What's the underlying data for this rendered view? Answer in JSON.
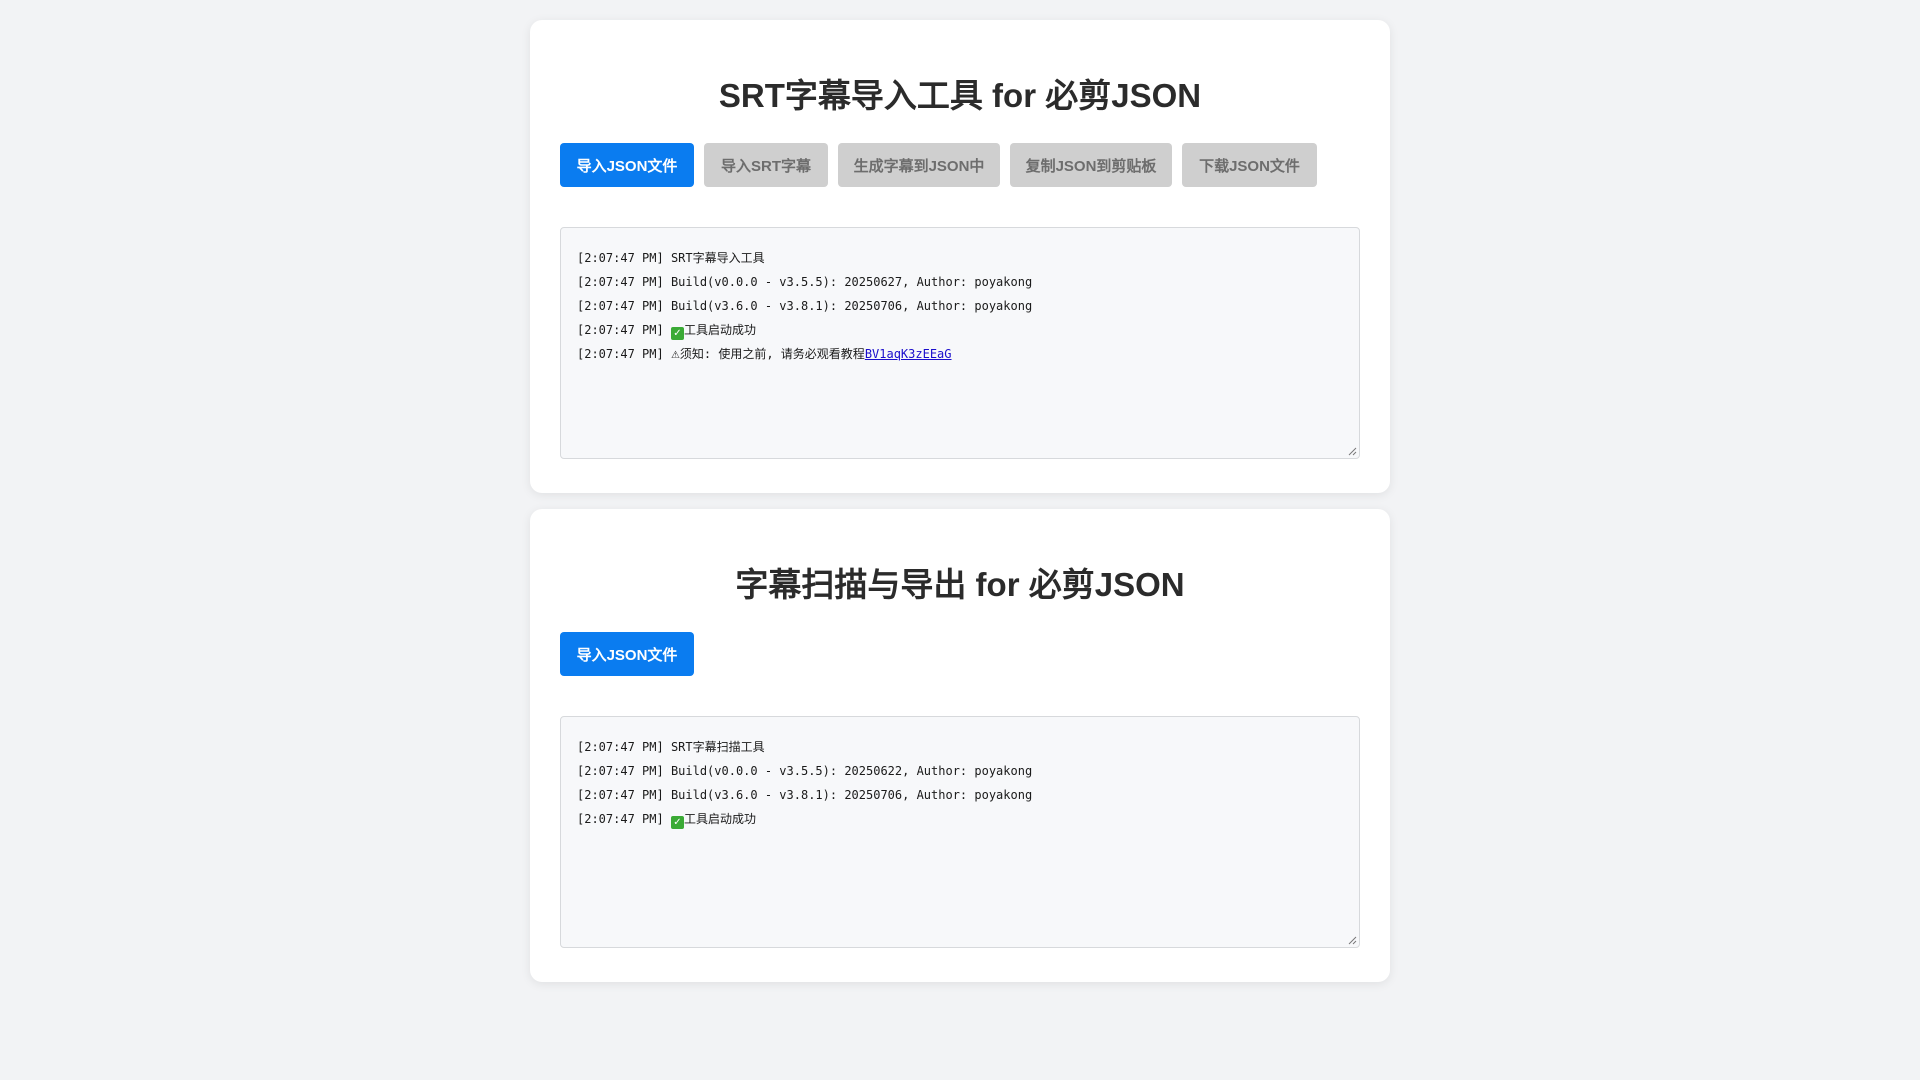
{
  "importer": {
    "title": "SRT字幕导入工具 for 必剪JSON",
    "buttons": [
      {
        "label": "导入JSON文件",
        "state": "active"
      },
      {
        "label": "导入SRT字幕",
        "state": "disabled"
      },
      {
        "label": "生成字幕到JSON中",
        "state": "disabled"
      },
      {
        "label": "复制JSON到剪贴板",
        "state": "disabled"
      },
      {
        "label": "下载JSON文件",
        "state": "disabled"
      }
    ],
    "log": [
      {
        "time": "[2:07:47 PM]",
        "text": "SRT字幕导入工具"
      },
      {
        "time": "[2:07:47 PM]",
        "text": "Build(v0.0.0 - v3.5.5): 20250627, Author: poyakong"
      },
      {
        "time": "[2:07:47 PM]",
        "text": "Build(v3.6.0 - v3.8.1): 20250706, Author: poyakong"
      },
      {
        "time": "[2:07:47 PM]",
        "icon": "check-icon",
        "text": "工具启动成功"
      },
      {
        "time": "[2:07:47 PM]",
        "icon": "warning-icon",
        "text": "须知: 使用之前, 请务必观看教程",
        "link": "BV1aqK3zEEaG"
      }
    ]
  },
  "scanner": {
    "title": "字幕扫描与导出 for 必剪JSON",
    "buttons": [
      {
        "label": "导入JSON文件",
        "state": "active"
      }
    ],
    "log": [
      {
        "time": "[2:07:47 PM]",
        "text": "SRT字幕扫描工具"
      },
      {
        "time": "[2:07:47 PM]",
        "text": "Build(v0.0.0 - v3.5.5): 20250622, Author: poyakong"
      },
      {
        "time": "[2:07:47 PM]",
        "text": "Build(v3.6.0 - v3.8.1): 20250706, Author: poyakong"
      },
      {
        "time": "[2:07:47 PM]",
        "icon": "check-icon",
        "text": "工具启动成功"
      }
    ]
  },
  "colors": {
    "primary": "#0a7cf0",
    "disabled": "#cfcfcf",
    "link": "#1a0dcc",
    "check": "#3aaa35"
  }
}
